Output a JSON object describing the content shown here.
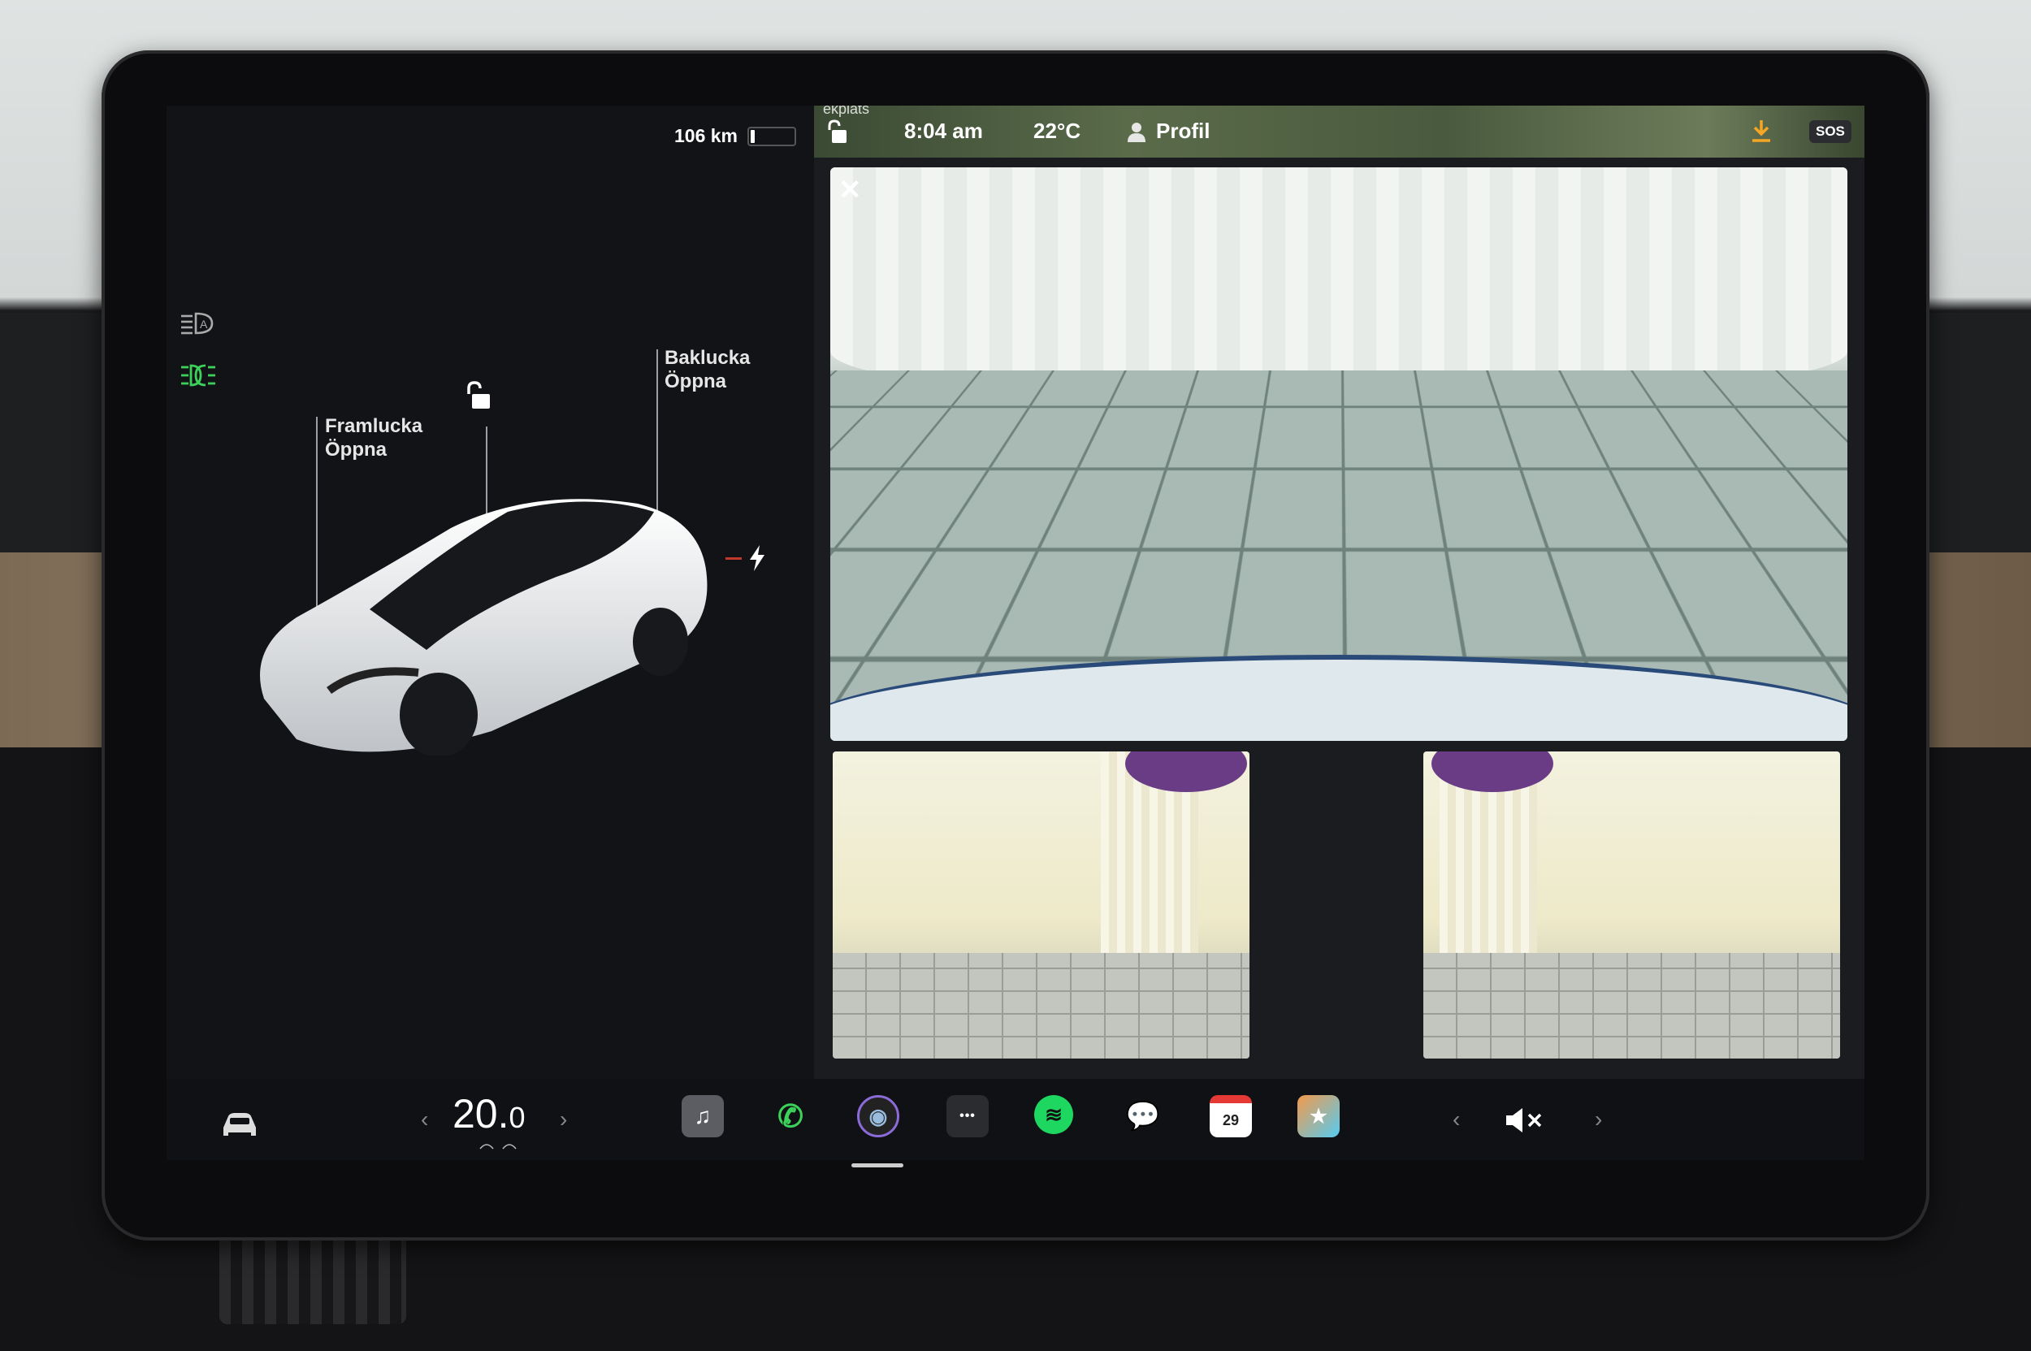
{
  "status_bar": {
    "range": "106 km",
    "battery_level": 0.1,
    "map_caption": "ekplats",
    "time": "8:04 am",
    "temperature": "22°C",
    "profile_label": "Profil",
    "sos_label": "SOS"
  },
  "car_panel": {
    "front_trunk": {
      "title": "Framlucka",
      "action": "Öppna"
    },
    "rear_trunk": {
      "title": "Baklucka",
      "action": "Öppna"
    },
    "lock_state_icon": "unlock-icon",
    "charge_port_icon": "lightning-icon",
    "light_icons": [
      "auto-highbeam-icon",
      "headlights-icon"
    ],
    "headlights_color": "#3bd15a"
  },
  "camera": {
    "close_icon": "close-icon",
    "views": [
      "rear-camera",
      "left-repeater-camera",
      "right-repeater-camera"
    ]
  },
  "bottom_bar": {
    "climate_temp_main": "20.",
    "climate_temp_decimal": "0",
    "apps": [
      {
        "name": "music",
        "glyph": "♫"
      },
      {
        "name": "phone",
        "glyph": "✆"
      },
      {
        "name": "camera",
        "glyph": "◉"
      },
      {
        "name": "more",
        "glyph": "•••"
      },
      {
        "name": "spotify",
        "glyph": "≋"
      },
      {
        "name": "messages",
        "glyph": "💬"
      },
      {
        "name": "calendar",
        "glyph": "29"
      },
      {
        "name": "toybox",
        "glyph": "★"
      }
    ],
    "volume_icon": "volume-mute-icon"
  },
  "colors": {
    "accent_green": "#3bd15a",
    "spotify_green": "#1ed760",
    "screen_bg": "#0f1013"
  }
}
